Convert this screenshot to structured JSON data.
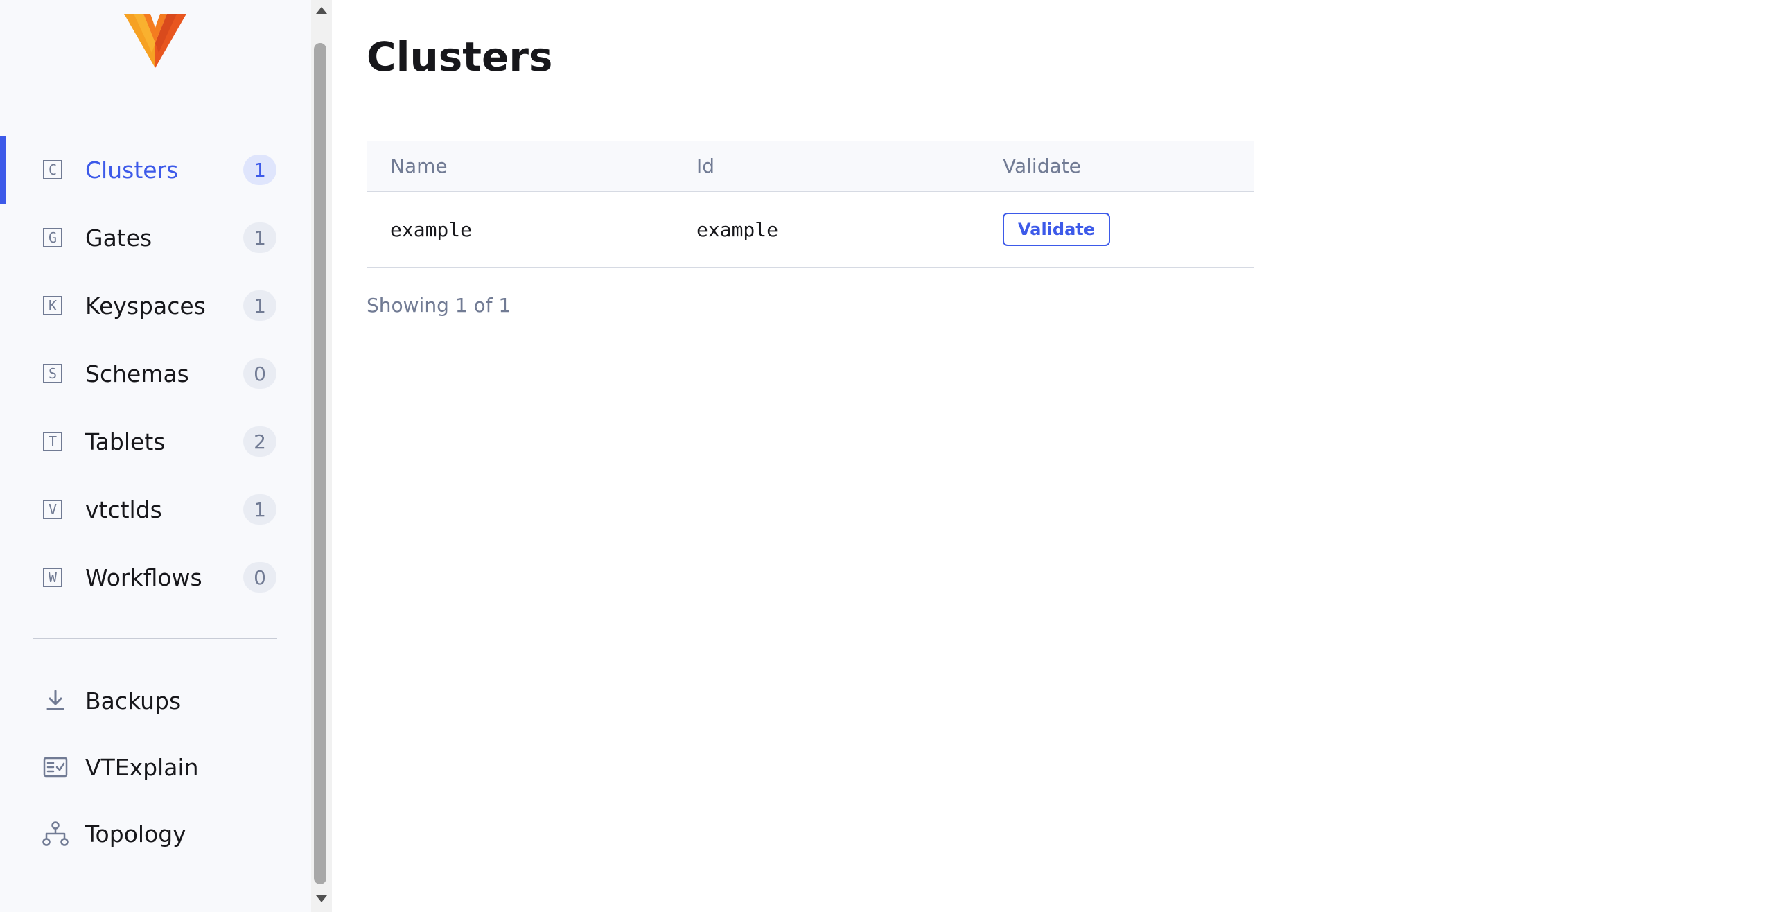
{
  "sidebar": {
    "nav": [
      {
        "icon_letter": "C",
        "label": "Clusters",
        "count": "1",
        "active": true
      },
      {
        "icon_letter": "G",
        "label": "Gates",
        "count": "1"
      },
      {
        "icon_letter": "K",
        "label": "Keyspaces",
        "count": "1"
      },
      {
        "icon_letter": "S",
        "label": "Schemas",
        "count": "0"
      },
      {
        "icon_letter": "T",
        "label": "Tablets",
        "count": "2"
      },
      {
        "icon_letter": "V",
        "label": "vtctlds",
        "count": "1"
      },
      {
        "icon_letter": "W",
        "label": "Workflows",
        "count": "0"
      }
    ],
    "tools": [
      {
        "icon": "download-icon",
        "label": "Backups"
      },
      {
        "icon": "checklist-icon",
        "label": "VTExplain"
      },
      {
        "icon": "topology-icon",
        "label": "Topology"
      }
    ]
  },
  "main": {
    "title": "Clusters",
    "table": {
      "headers": [
        "Name",
        "Id",
        "Validate"
      ],
      "rows": [
        {
          "name": "example",
          "id": "example",
          "action": "Validate"
        }
      ]
    },
    "footer": "Showing 1 of 1"
  },
  "colors": {
    "accent": "#3d5ae9",
    "muted": "#717b94",
    "sidebar_bg": "#f8f9fc"
  }
}
